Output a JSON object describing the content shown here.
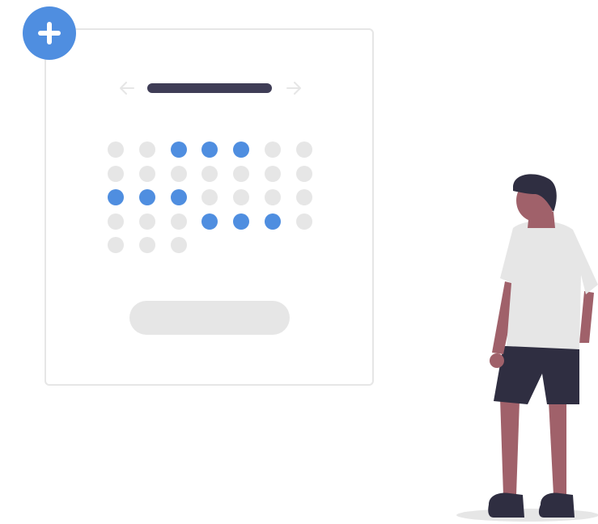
{
  "colors": {
    "accent": "#4f8ee0",
    "inactive_dot": "#e6e6e6",
    "bar_dark": "#3f3d56",
    "arrow": "#e6e6e6",
    "pill": "#e6e6e6",
    "skin": "#a0616a",
    "hair": "#2f2e41",
    "shirt": "#e6e6e6",
    "shorts": "#2f2e41",
    "shadow": "#e6e6e6"
  },
  "icons": {
    "add": "plus-icon",
    "prev": "arrow-left-icon",
    "next": "arrow-right-icon"
  },
  "calendar": {
    "columns": 7,
    "rows": [
      [
        false,
        false,
        true,
        true,
        true,
        false,
        false
      ],
      [
        false,
        false,
        false,
        false,
        false,
        false,
        false
      ],
      [
        true,
        true,
        true,
        false,
        false,
        false,
        false
      ],
      [
        false,
        false,
        false,
        true,
        true,
        true,
        false
      ],
      [
        false,
        false,
        false
      ]
    ]
  }
}
